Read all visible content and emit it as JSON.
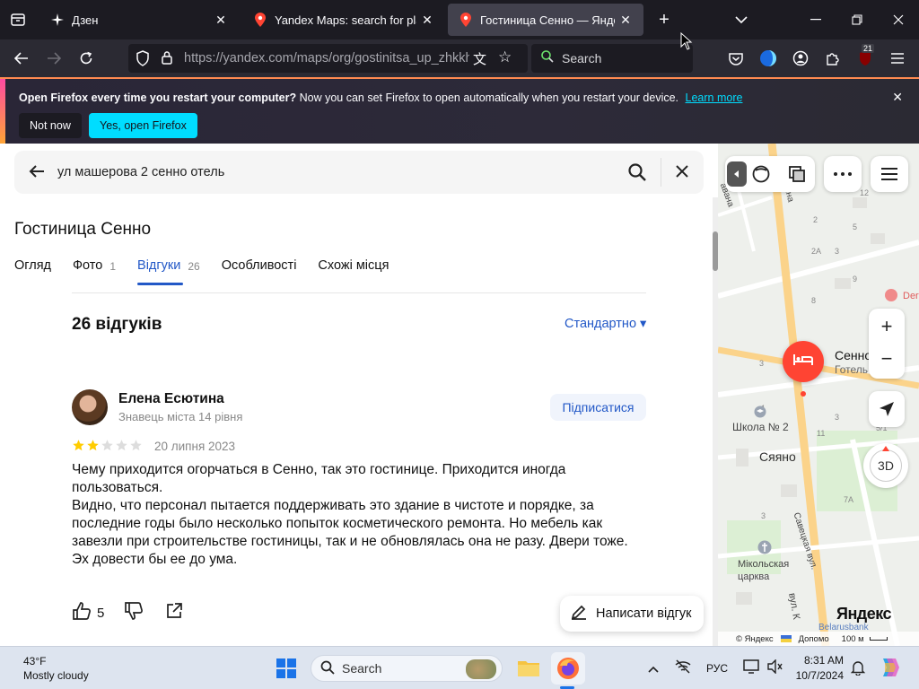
{
  "browser": {
    "tabs": [
      {
        "title": "Дзен",
        "icon": "dzen-icon"
      },
      {
        "title": "Yandex Maps: search for places",
        "icon": "yandex-maps-pin-icon"
      },
      {
        "title": "Гостиница Сенно — Яндекс К",
        "icon": "yandex-maps-pin-icon",
        "active": true
      }
    ],
    "url": "https://yandex.com/maps/org/gostinitsa_up_zhkkh/",
    "search_placeholder": "Search",
    "extension_badge": "21"
  },
  "notification": {
    "bold": "Open Firefox every time you restart your computer?",
    "text": " Now you can set Firefox to open automatically when you restart your device.",
    "learn_more": "Learn more",
    "not_now": "Not now",
    "yes_open": "Yes, open Firefox"
  },
  "panel": {
    "search_query": "ул машерова 2 сенно отель",
    "org_title": "Гостиница Сенно",
    "tabs": [
      {
        "label": "Огляд",
        "count": ""
      },
      {
        "label": "Фото",
        "count": "1"
      },
      {
        "label": "Відгуки",
        "count": "26"
      },
      {
        "label": "Особливості",
        "count": ""
      },
      {
        "label": "Схожі місця",
        "count": ""
      }
    ],
    "reviews_count": "26 відгуків",
    "sort_label": "Стандартно ▾",
    "review": {
      "author": "Елена Есютина",
      "level": "Знавець міста 14 рівня",
      "subscribe": "Підписатися",
      "rating": 2,
      "date": "20 липня 2023",
      "lines": [
        "Чему приходится огорчаться в Сенно, так это гостинице. Приходится иногда пользоваться.",
        "Видно, что персонал пытается поддерживать это здание в чистоте и порядке, за последние годы было несколько попыток косметического ремонта. Но мебель как завезли при строительстве гостиницы, так и не обновлялась она не разу. Двери тоже.",
        "Эх довести бы ее до ума."
      ],
      "likes": "5"
    },
    "write_review": "Написати відгук"
  },
  "map": {
    "place_name": "Сенно",
    "place_category": "Готель",
    "labels": {
      "school": "Школа № 2",
      "city": "Сяяно",
      "church": "Мікольская царква",
      "street1": "Савецкая вул.",
      "street2": "вул. К",
      "street3": "улiна",
      "street4": "авана",
      "poi_right": "Der",
      "bank": "Belarusbank"
    },
    "controls": {
      "mode3d": "3D"
    },
    "brand": "Яндекс",
    "copyright": "© Яндекс",
    "help": "Допомо",
    "scale": "100 м",
    "house_numbers": [
      "12",
      "2",
      "5",
      "2A",
      "3",
      "9",
      "8",
      "3",
      "1",
      "3",
      "11",
      "13",
      "5/1",
      "7A",
      "3"
    ]
  },
  "taskbar": {
    "temp": "43°F",
    "weather": "Mostly cloudy",
    "search": "Search",
    "lang": "РУС",
    "time": "8:31 AM",
    "date": "10/7/2024"
  },
  "colors": {
    "link": "#2258c7",
    "accent_cyan": "#00ddff",
    "marker_red": "#f43",
    "star": "#fc0"
  }
}
